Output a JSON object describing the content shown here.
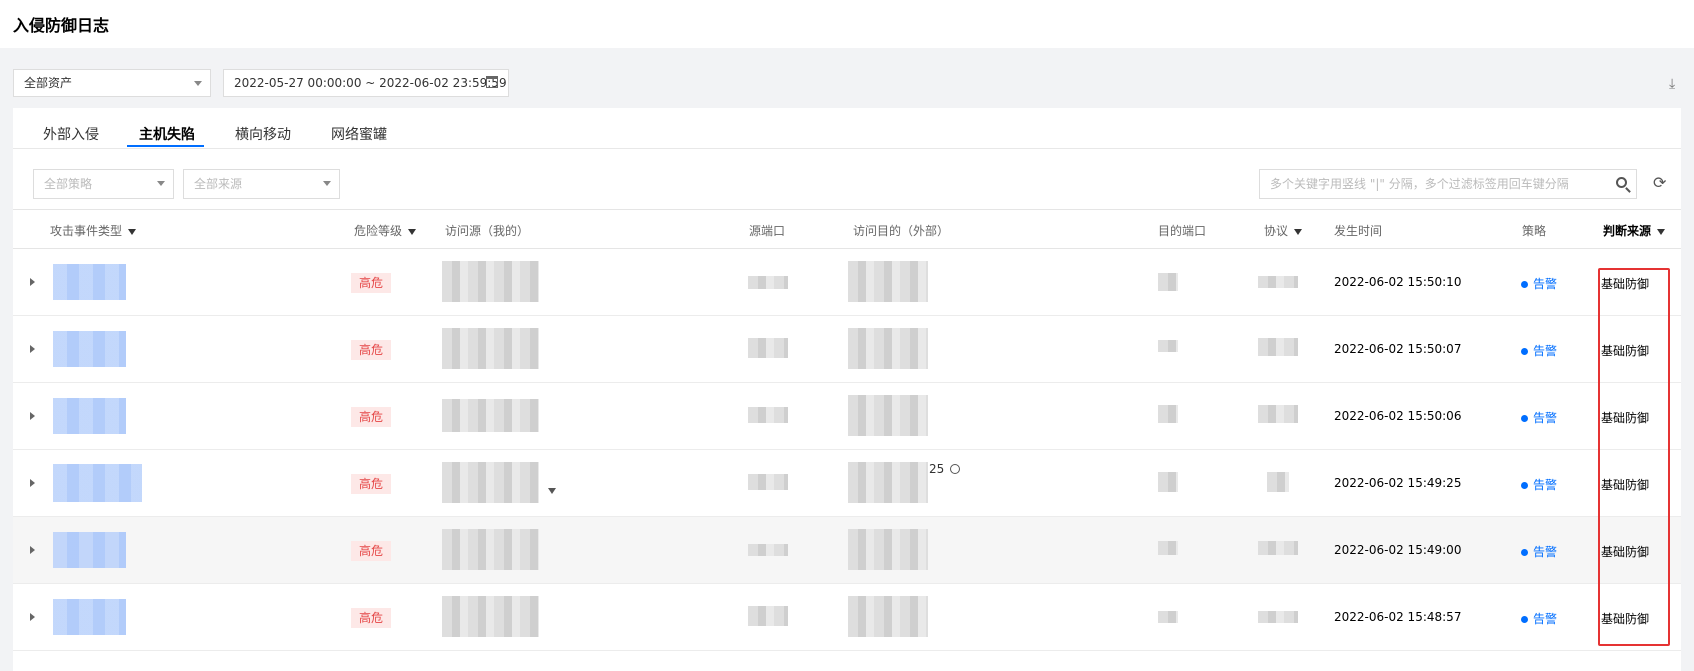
{
  "page": {
    "title": "入侵防御日志"
  },
  "toolbar": {
    "asset_select": "全部资产",
    "date_range": "2022-05-27 00:00:00 ~ 2022-06-02 23:59:59"
  },
  "tabs": [
    "外部入侵",
    "主机失陷",
    "横向移动",
    "网络蜜罐"
  ],
  "active_tab": "主机失陷",
  "filters": {
    "policy_placeholder": "全部策略",
    "source_placeholder": "全部来源",
    "search_placeholder": "多个关键字用竖线 \"|\" 分隔，多个过滤标签用回车键分隔"
  },
  "table": {
    "columns": [
      "攻击事件类型",
      "危险等级",
      "访问源（我的）",
      "源端口",
      "访问目的（外部）",
      "目的端口",
      "协议",
      "发生时间",
      "策略",
      "判断来源"
    ],
    "rows": [
      {
        "risk": "高危",
        "time": "2022-06-02 15:50:10",
        "policy": "告警",
        "source": "基础防御"
      },
      {
        "risk": "高危",
        "time": "2022-06-02 15:50:07",
        "policy": "告警",
        "source": "基础防御"
      },
      {
        "risk": "高危",
        "time": "2022-06-02 15:50:06",
        "policy": "告警",
        "source": "基础防御"
      },
      {
        "risk": "高危",
        "time": "2022-06-02 15:49:25",
        "policy": "告警",
        "source": "基础防御",
        "dest_partial": "25"
      },
      {
        "risk": "高危",
        "time": "2022-06-02 15:49:00",
        "policy": "告警",
        "source": "基础防御"
      },
      {
        "risk": "高危",
        "time": "2022-06-02 15:48:57",
        "policy": "告警",
        "source": "基础防御"
      }
    ]
  },
  "colors": {
    "accent": "#006eff",
    "danger": "#e54545",
    "highlight_box": "#e53333"
  }
}
